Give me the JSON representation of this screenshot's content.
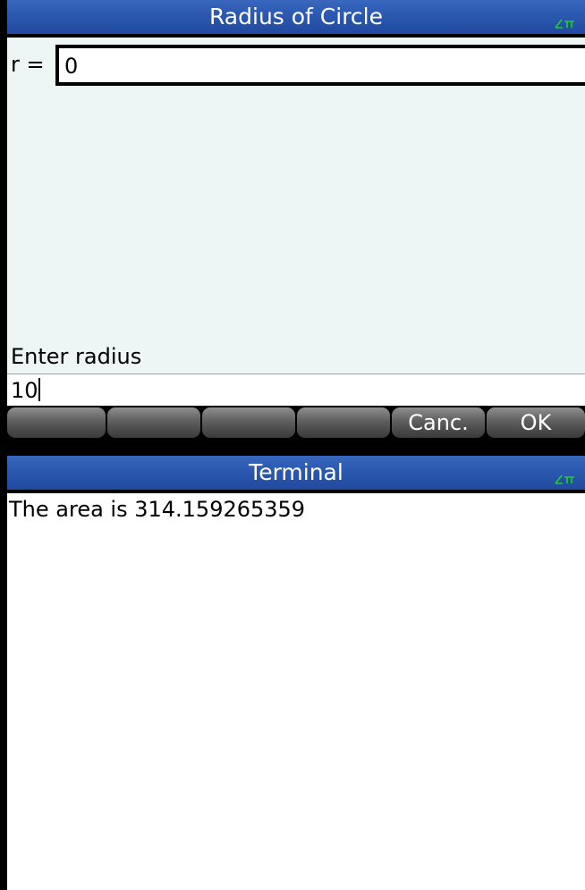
{
  "input_form": {
    "title": "Radius of Circle",
    "angle_mode_icon": "angle-radian-icon",
    "field": {
      "label": "r =",
      "value": "0"
    },
    "help": "Enter radius",
    "edit_line": "10",
    "softkeys": [
      "",
      "",
      "",
      "",
      "Canc.",
      "OK"
    ]
  },
  "terminal": {
    "title": "Terminal",
    "angle_mode_icon": "angle-radian-icon",
    "lines": [
      "The area is 314.159265359"
    ]
  },
  "colors": {
    "titlebar": "#2c58b0",
    "title_text": "#ffffff",
    "angle_icon": "#1fd12a",
    "form_background": "#eef5f5",
    "softkey": "#5e5e5e"
  }
}
